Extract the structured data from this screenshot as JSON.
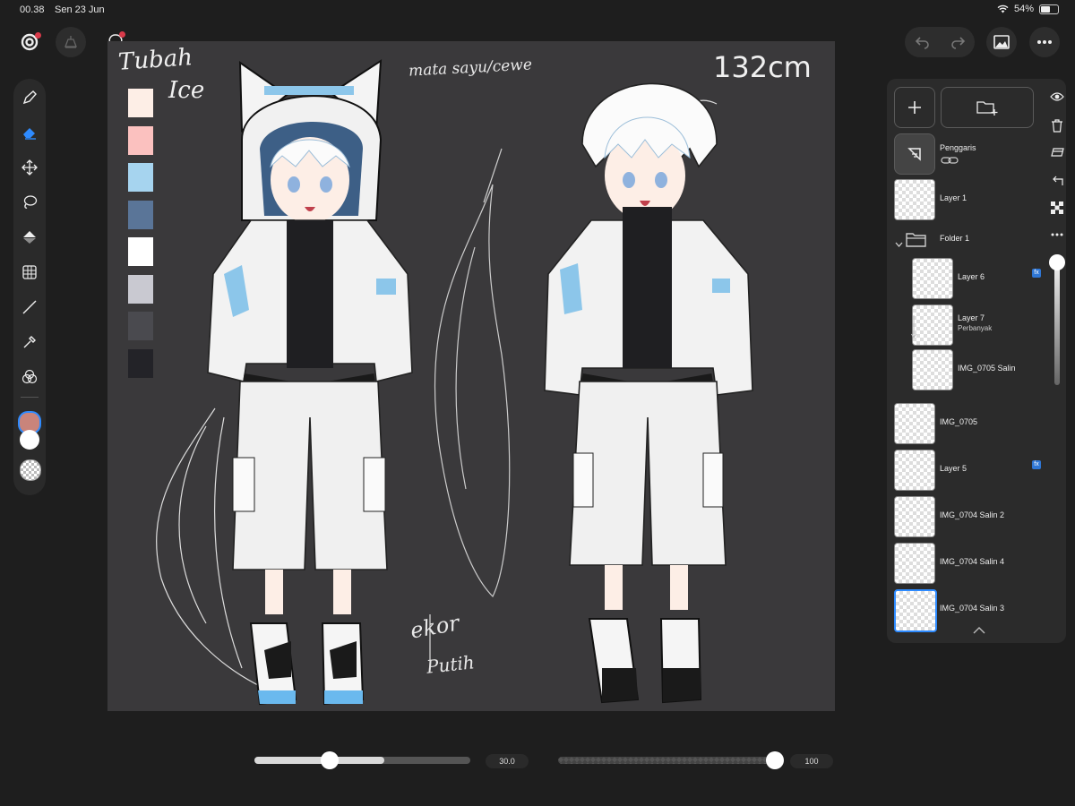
{
  "status_bar": {
    "time": "00.38",
    "date": "Sen 23 Jun",
    "battery_text": "54%",
    "battery_level": 0.54
  },
  "top_bar": {
    "left_buttons": [
      "gallery-icon",
      "lightbulb-icon"
    ],
    "right_buttons": [
      "undo-icon",
      "redo-icon",
      "image-icon",
      "more-icon"
    ]
  },
  "toolbar": {
    "tools": [
      "brush-icon",
      "eraser-icon",
      "move-icon",
      "lasso-icon",
      "fill-icon",
      "transform-icon",
      "line-icon",
      "eyedropper-icon",
      "blend-icon"
    ],
    "active_tool": "eraser-icon",
    "colors": {
      "primary": "#c9847b",
      "secondary": "#ffffff",
      "transparent": "checker"
    }
  },
  "canvas": {
    "annotations": {
      "top_left_1": "Tubah",
      "top_left_2": "Ice",
      "middle_top": "mata sayu/cewe",
      "height": "132cm",
      "tail_1": "ekor",
      "tail_2": "Putih"
    },
    "palette": [
      "#fdeee6",
      "#fbc1bf",
      "#a6d4ef",
      "#5a7598",
      "#ffffff",
      "#c9c9d1",
      "#4a4a4f",
      "#232328"
    ]
  },
  "layers_panel": {
    "ruler_layer": "Penggaris",
    "layers": [
      {
        "name": "Layer 1",
        "sub": "",
        "fx": false,
        "indent": 0,
        "selected": false
      },
      {
        "name": "Folder 1",
        "sub": "",
        "fx": false,
        "indent": 0,
        "selected": false,
        "is_folder": true
      },
      {
        "name": "Layer 6",
        "sub": "",
        "fx": true,
        "indent": 1,
        "selected": false
      },
      {
        "name": "Layer 7",
        "sub": "Perbanyak",
        "fx": false,
        "indent": 1,
        "selected": false
      },
      {
        "name": "IMG_0705 Salin",
        "sub": "",
        "fx": false,
        "indent": 1,
        "selected": false
      },
      {
        "name": "IMG_0705",
        "sub": "",
        "fx": false,
        "indent": 0,
        "selected": false
      },
      {
        "name": "Layer 5",
        "sub": "",
        "fx": true,
        "indent": 0,
        "selected": false
      },
      {
        "name": "IMG_0704 Salin 2",
        "sub": "",
        "fx": false,
        "indent": 0,
        "selected": false
      },
      {
        "name": "IMG_0704 Salin 4",
        "sub": "",
        "fx": false,
        "indent": 0,
        "selected": false
      },
      {
        "name": "IMG_0704 Salin 3",
        "sub": "",
        "fx": false,
        "indent": 0,
        "selected": true
      }
    ],
    "fx_label": "fx",
    "layer_opacity": 1.0
  },
  "bottom_sliders": {
    "brush_size": {
      "value": 30.0,
      "label": "30.0",
      "max": 50
    },
    "opacity": {
      "value": 100,
      "label": "100",
      "max": 100
    }
  }
}
